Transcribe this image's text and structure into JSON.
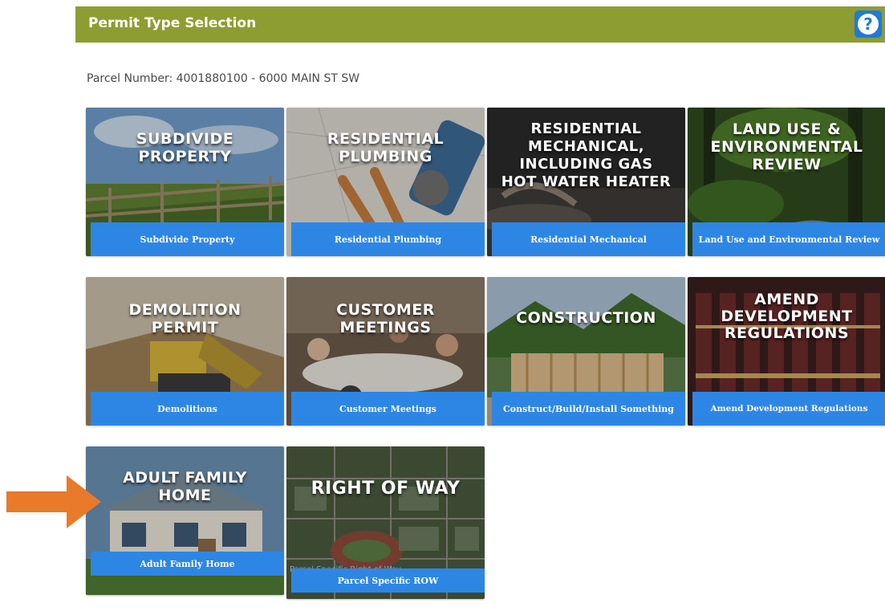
{
  "header": {
    "title": "Permit Type Selection",
    "help_glyph": "?"
  },
  "parcel": {
    "text": "Parcel Number: 4001880100 - 6000 MAIN ST SW"
  },
  "colors": {
    "header": "#8e9d32",
    "label": "#2e86e4",
    "help": "#1f7ad8",
    "arrow": "#e87a2a"
  },
  "tiles": [
    {
      "title": "SUBDIVIDE\nPROPERTY",
      "label": "Subdivide Property",
      "icon": "fence-field-photo"
    },
    {
      "title": "RESIDENTIAL\nPLUMBING",
      "label": "Residential Plumbing",
      "icon": "pipes-wrench-photo"
    },
    {
      "title": "RESIDENTIAL\nMECHANICAL,\nINCLUDING GAS\nHOT WATER HEATER",
      "label": "Residential Mechanical",
      "icon": "water-heater-photo"
    },
    {
      "title": "LAND USE &\nENVIRONMENTAL\nREVIEW",
      "label": "Land Use and Environmental Review",
      "icon": "forest-stream-photo"
    },
    {
      "title": "DEMOLITION\nPERMIT",
      "label": "Demolitions",
      "icon": "bulldozer-photo"
    },
    {
      "title": "CUSTOMER\nMEETINGS",
      "label": "Customer Meetings",
      "icon": "meeting-room-photo"
    },
    {
      "title": "CONSTRUCTION",
      "label": "Construct/Build/Install Something",
      "icon": "house-frame-photo"
    },
    {
      "title": "AMEND\nDEVELOPMENT\nREGULATIONS",
      "label": "Amend Development Regulations",
      "icon": "law-books-photo"
    },
    {
      "title": "ADULT FAMILY\nHOME",
      "label": "Adult Family Home",
      "icon": "house-photo"
    },
    {
      "title": "RIGHT OF WAY",
      "label": "Parcel Specific ROW",
      "icon": "aerial-map-photo",
      "faint_caption": "Parcel Specific Right of Way"
    }
  ]
}
